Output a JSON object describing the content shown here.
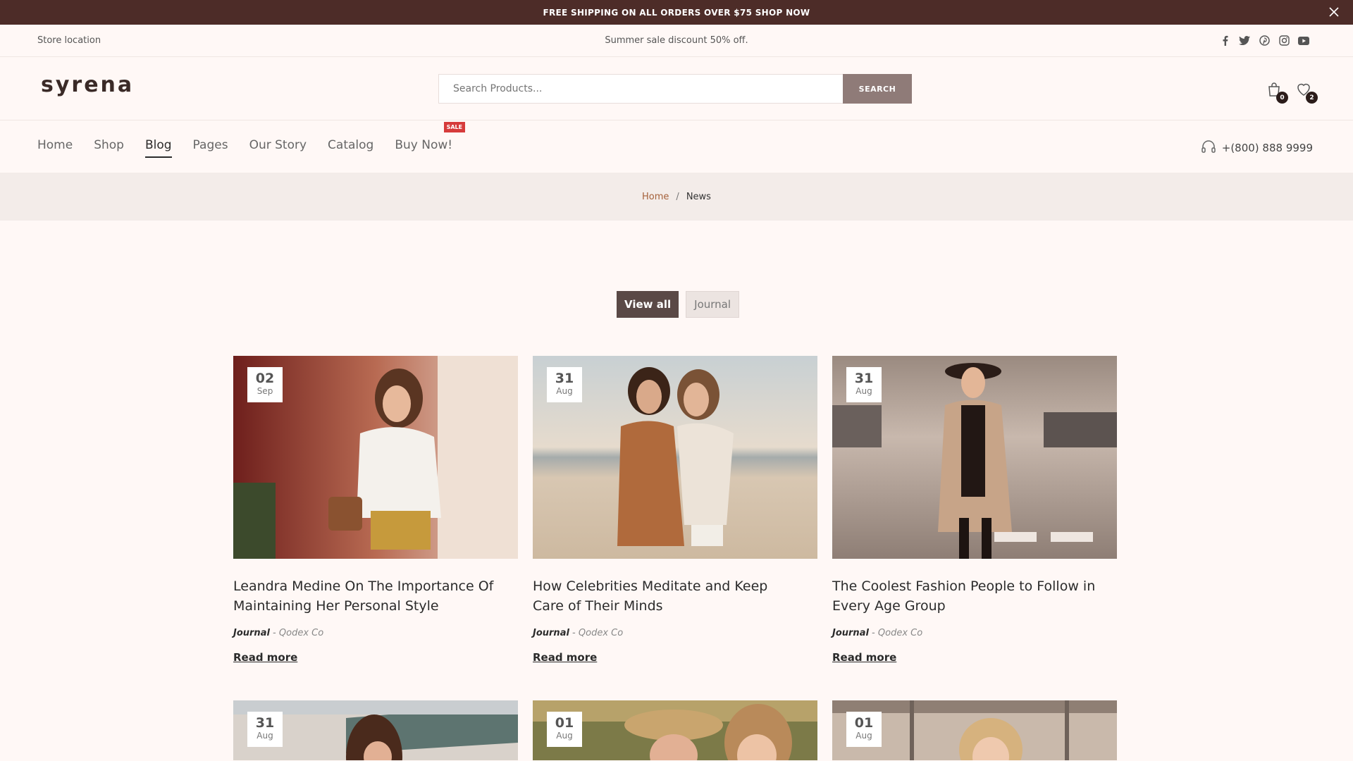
{
  "announcement": {
    "text": "FREE SHIPPING ON ALL ORDERS OVER $75 SHOP NOW"
  },
  "topbar": {
    "location": "Store location",
    "promo": "Summer sale discount 50% off."
  },
  "logo": "syrena",
  "search": {
    "placeholder": "Search Products...",
    "button": "SEARCH"
  },
  "cart": {
    "count": "0"
  },
  "wishlist": {
    "count": "2"
  },
  "nav": {
    "items": [
      "Home",
      "Shop",
      "Blog",
      "Pages",
      "Our Story",
      "Catalog",
      "Buy Now!"
    ],
    "active": "Blog",
    "sale_badge": "SALE",
    "phone": "+(800) 888 9999"
  },
  "breadcrumb": {
    "home": "Home",
    "sep": "/",
    "current": "News"
  },
  "filters": {
    "view_all": "View all",
    "journal": "Journal"
  },
  "posts": [
    {
      "day": "02",
      "month": "Sep",
      "title": "Leandra Medine On The Importance Of Maintaining Her Personal Style",
      "category": "Journal",
      "author": "Qodex Co",
      "more": "Read more"
    },
    {
      "day": "31",
      "month": "Aug",
      "title": "How Celebrities Meditate and Keep Care of Their Minds",
      "category": "Journal",
      "author": "Qodex Co",
      "more": "Read more"
    },
    {
      "day": "31",
      "month": "Aug",
      "title": "The Coolest Fashion People to Follow in Every Age Group",
      "category": "Journal",
      "author": "Qodex Co",
      "more": "Read more"
    },
    {
      "day": "31",
      "month": "Aug"
    },
    {
      "day": "01",
      "month": "Aug"
    },
    {
      "day": "01",
      "month": "Aug"
    }
  ],
  "colors": {
    "announcement_bg": "#4d2c28",
    "accent": "#a5613b",
    "search_button": "#8f7b78",
    "sale": "#d63b3b"
  }
}
